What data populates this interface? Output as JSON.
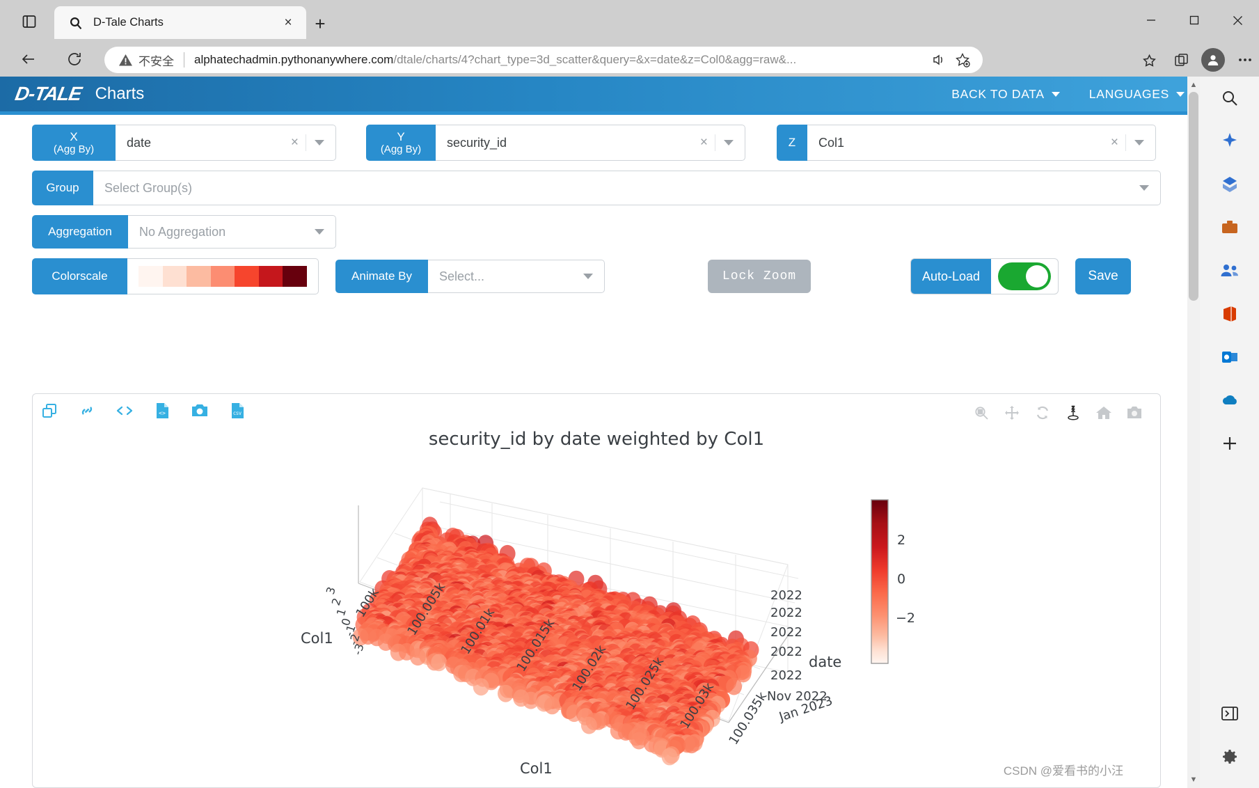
{
  "browser": {
    "tab": {
      "title": "D-Tale Charts",
      "favicon": "search-icon",
      "close": "×"
    },
    "new_tab": "+",
    "window_controls": {
      "minimize": "minimize-icon",
      "maximize": "maximize-icon",
      "close": "close-icon"
    },
    "security_label": "不安全",
    "url_domain": "alphatechadmin.pythonanywhere.com",
    "url_path": "/dtale/charts/4?chart_type=3d_scatter&query=&x=date&z=Col0&agg=raw&...",
    "nav": {
      "back": "back-arrow-icon",
      "reload": "reload-icon"
    },
    "toolbar_icons": [
      "read-aloud-icon",
      "favorite-add-icon",
      "collections-icon",
      "browser-essentials-icon",
      "profile-icon",
      "settings-more-icon"
    ]
  },
  "app": {
    "logo": "D-TALE",
    "subtitle": "Charts",
    "links": [
      {
        "label": "BACK TO DATA",
        "caret": true
      },
      {
        "label": "LANGUAGES",
        "caret": true
      }
    ]
  },
  "controls": {
    "x": {
      "label": "X",
      "sublabel": "(Agg By)",
      "value": "date",
      "clear": "×"
    },
    "y": {
      "label": "Y",
      "sublabel": "(Agg By)",
      "value": "security_id",
      "clear": "×"
    },
    "z": {
      "label": "Z",
      "value": "Col1",
      "clear": "×"
    },
    "group": {
      "label": "Group",
      "placeholder": "Select Group(s)",
      "value": ""
    },
    "aggregation": {
      "label": "Aggregation",
      "value": "No Aggregation"
    },
    "colorscale": {
      "label": "Colorscale",
      "swatches": [
        "#fff5f0",
        "#fee0d2",
        "#fcbba1",
        "#fc8d72",
        "#f6452d",
        "#c5171c",
        "#67000d"
      ]
    },
    "animate_by": {
      "label": "Animate By",
      "placeholder": "Select...",
      "value": ""
    },
    "lock_zoom": {
      "label": "Lock Zoom",
      "disabled": true
    },
    "auto_load": {
      "label": "Auto-Load",
      "enabled": true
    },
    "save": {
      "label": "Save"
    }
  },
  "chart_toolbar": [
    "copy-windows-icon",
    "link-icon",
    "code-brackets-icon",
    "file-code-icon",
    "camera-icon",
    "csv-file-icon"
  ],
  "modebar": [
    "zoom-icon",
    "pan-icon",
    "orbit-rotate-icon",
    "turntable-rotate-icon",
    "reset-home-icon",
    "reset-camera-icon"
  ],
  "chart_data": {
    "type": "scatter",
    "title": "security_id by date weighted by Col1",
    "xlabel": "date",
    "ylabel": "Col1",
    "zlabel": "Col1",
    "x_ticks": [
      "2022",
      "2022",
      "2022",
      "2022",
      "2022",
      "Nov 2022",
      "Jan 2023"
    ],
    "y_ticks": [
      "100k",
      "100.005k",
      "100.01k",
      "100.015k",
      "100.02k",
      "100.025k",
      "100.03k",
      "100.035k"
    ],
    "z_ticks": [
      "3",
      "2",
      "1",
      "0",
      "-1",
      "-2",
      "-3"
    ],
    "zlim": [
      -3,
      3
    ],
    "ylim": [
      100000,
      100040
    ],
    "colorbar": {
      "ticks": [
        "2",
        "0",
        "−2"
      ],
      "cmin": -3.2,
      "cmax": 3.2,
      "colorscale": "Reds"
    },
    "marker_count": 3000,
    "grid": true,
    "legend": "none"
  },
  "watermark": "CSDN @爱看书的小汪"
}
